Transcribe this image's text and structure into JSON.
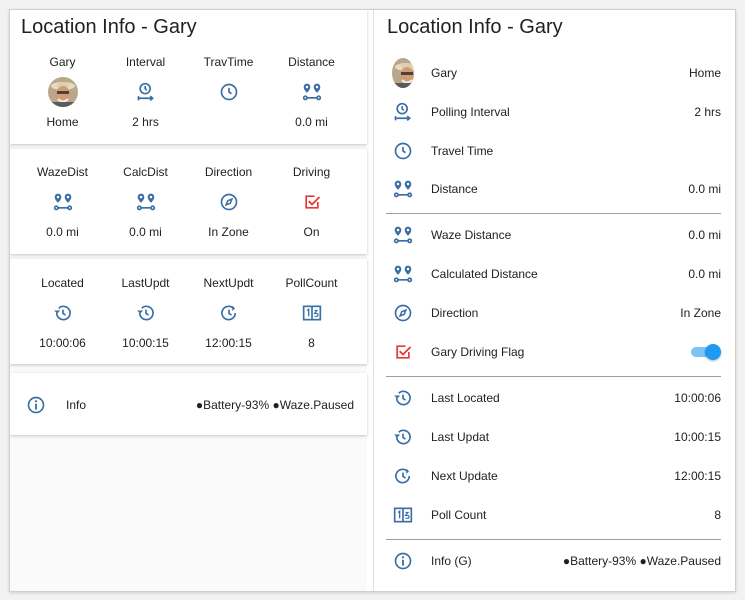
{
  "left": {
    "card1": {
      "title": "Location Info - Gary",
      "cells": [
        {
          "label": "Gary",
          "icon": "avatar",
          "value": "Home"
        },
        {
          "label": "Interval",
          "icon": "timer-interval-icon",
          "value": "2 hrs"
        },
        {
          "label": "TravTime",
          "icon": "clock-icon",
          "value": ""
        },
        {
          "label": "Distance",
          "icon": "map-marker-distance-icon",
          "value": "0.0 mi"
        }
      ]
    },
    "card2": {
      "cells": [
        {
          "label": "WazeDist",
          "icon": "map-marker-distance-icon",
          "value": "0.0 mi"
        },
        {
          "label": "CalcDist",
          "icon": "map-marker-distance-icon",
          "value": "0.0 mi"
        },
        {
          "label": "Direction",
          "icon": "compass-icon",
          "value": "In Zone"
        },
        {
          "label": "Driving",
          "icon": "checkbox-marked-icon",
          "value": "On"
        }
      ]
    },
    "card3": {
      "cells": [
        {
          "label": "Located",
          "icon": "history-icon",
          "value": "10:00:06"
        },
        {
          "label": "LastUpdt",
          "icon": "history-icon",
          "value": "10:00:15"
        },
        {
          "label": "NextUpdt",
          "icon": "restore-clock-icon",
          "value": "12:00:15"
        },
        {
          "label": "PollCount",
          "icon": "counter-icon",
          "value": "8"
        }
      ]
    },
    "card4": {
      "label": "Info",
      "icon": "info-icon",
      "value": "●Battery-93% ●Waze.Paused"
    }
  },
  "right": {
    "title": "Location Info - Gary",
    "rows": [
      {
        "label": "Gary",
        "icon": "avatar",
        "value": "Home"
      },
      {
        "label": "Polling Interval",
        "icon": "timer-interval-icon",
        "value": "2 hrs"
      },
      {
        "label": "Travel Time",
        "icon": "clock-icon",
        "value": ""
      },
      {
        "label": "Distance",
        "icon": "map-marker-distance-icon",
        "value": "0.0 mi"
      },
      {
        "label": "Waze Distance",
        "icon": "map-marker-distance-icon",
        "value": "0.0 mi"
      },
      {
        "label": "Calculated Distance",
        "icon": "map-marker-distance-icon",
        "value": "0.0 mi"
      },
      {
        "label": "Direction",
        "icon": "compass-icon",
        "value": "In Zone"
      },
      {
        "label": "Gary Driving Flag",
        "icon": "checkbox-marked-icon",
        "value": "",
        "toggle": true
      },
      {
        "label": "Last Located",
        "icon": "history-icon",
        "value": "10:00:06"
      },
      {
        "label": "Last Updat",
        "icon": "history-icon",
        "value": "10:00:15"
      },
      {
        "label": "Next Update",
        "icon": "restore-clock-icon",
        "value": "12:00:15"
      },
      {
        "label": "Poll Count",
        "icon": "counter-icon",
        "value": "8"
      },
      {
        "label": "Info (G)",
        "icon": "info-icon",
        "value": "●Battery-93% ●Waze.Paused"
      }
    ]
  },
  "colors": {
    "icon": "#3b6ea5",
    "red": "#e53935",
    "toggle": "#1e9bf0"
  }
}
